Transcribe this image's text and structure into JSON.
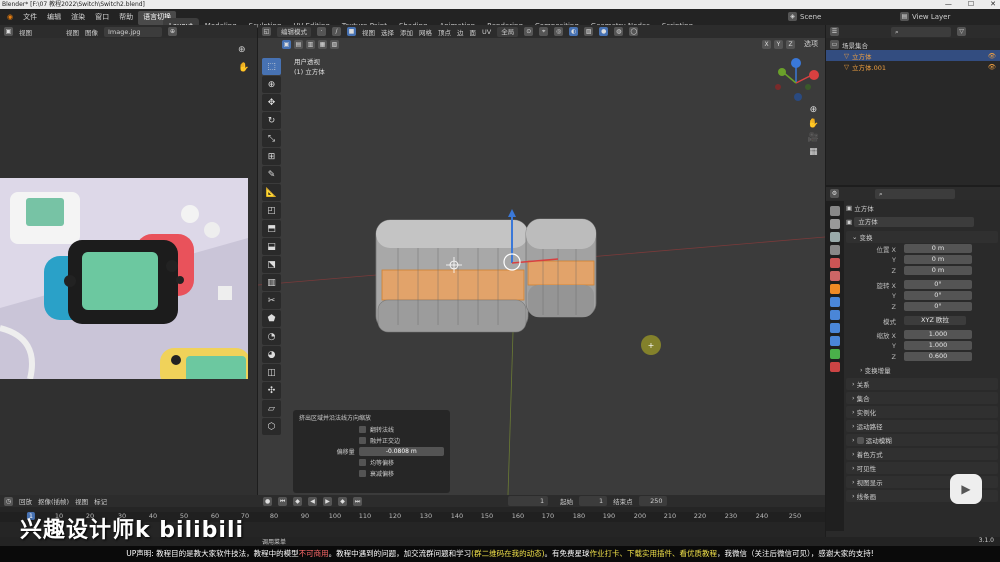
{
  "titlebar": {
    "text": "Blender* [F:\\07 教程2022\\Switch\\Switch2.blend]",
    "controls": [
      "—",
      "☐",
      "✕"
    ]
  },
  "menu": [
    "文件",
    "编辑",
    "渲染",
    "窗口",
    "帮助",
    "语言切换"
  ],
  "workspaces": [
    "Layout",
    "Modeling",
    "Sculpting",
    "UV Editing",
    "Texture Paint",
    "Shading",
    "Animation",
    "Rendering",
    "Compositing",
    "Geometry Nodes",
    "Scripting"
  ],
  "scene_label": "Scene",
  "view_layer_label": "View Layer",
  "image_editor": {
    "menus": [
      "视图",
      "视图",
      "图像"
    ],
    "image_name": "Image.jpg"
  },
  "viewport": {
    "mode": "编辑模式",
    "menus": [
      "视图",
      "选择",
      "添加",
      "网格",
      "顶点",
      "边",
      "面",
      "UV"
    ],
    "orientation": "全局",
    "options_label": "选项",
    "axis_buttons": [
      "X",
      "Y",
      "Z"
    ],
    "view_name": "用户透视",
    "object_name": "(1) 立方体",
    "gizmo": {
      "x": "X",
      "y": "Y",
      "z": "Z"
    }
  },
  "operator_panel": {
    "title": "挤出区域并沿法线方向缩放",
    "flip_normals": "翻转法线",
    "dissolve": "融并正交边",
    "offset_label": "偏移量",
    "offset_value": "-0.0808 m",
    "even_thickness": "均等偏移",
    "offset_falloff": "衰减偏移"
  },
  "outliner": {
    "scene_collection": "场景集合",
    "items": [
      {
        "name": "立方体",
        "selected": true
      },
      {
        "name": "立方体.001",
        "selected": false
      }
    ]
  },
  "properties": {
    "object_name": "立方体",
    "object_data": "立方体",
    "transform_label": "变换",
    "location_label": "位置 X",
    "location": {
      "x": "0 m",
      "y": "0 m",
      "z": "0 m"
    },
    "rotation_label": "旋转 X",
    "rotation": {
      "x": "0°",
      "y": "0°",
      "z": "0°"
    },
    "mode_label": "模式",
    "mode_value": "XYZ 欧拉",
    "scale_label": "缩放 X",
    "scale": {
      "x": "1.000",
      "y": "1.000",
      "z": "0.600"
    },
    "axis_labels": {
      "y": "Y",
      "z": "Z"
    },
    "delta_transform": "变换增量",
    "sections": [
      "关系",
      "集合",
      "实例化",
      "运动路径",
      "运动模糊",
      "着色方式",
      "可见性",
      "视图显示",
      "线条画"
    ]
  },
  "timeline": {
    "menus": [
      "回放",
      "抠像(插帧)",
      "视图",
      "标记"
    ],
    "current_frame": "1",
    "start_label": "起始",
    "start_value": "1",
    "end_label": "结束点",
    "end_value": "250",
    "ticks": [
      "1",
      "10",
      "20",
      "30",
      "40",
      "50",
      "60",
      "70",
      "80",
      "90",
      "100",
      "110",
      "120",
      "130",
      "140",
      "150",
      "160",
      "170",
      "180",
      "190",
      "200",
      "210",
      "220",
      "230",
      "240",
      "250"
    ]
  },
  "statusbar": {
    "text": "调用菜单",
    "version": "3.1.0"
  },
  "watermark": "兴趣设计师k bilibili",
  "caption": {
    "part1": "UP声明: 教程目的是教大家软件技法，教程中的模型",
    "red1": "不可商用",
    "part2": "。教程中遇到的问题，加交流群问题和学习",
    "y1": "(群二维码在我的动态)",
    "part3": "。有免费星球",
    "y2": "作业打卡、下载实用插件、看优质教程",
    "part4": "，我微信（关注后微信可见），感谢大家的支持!"
  }
}
